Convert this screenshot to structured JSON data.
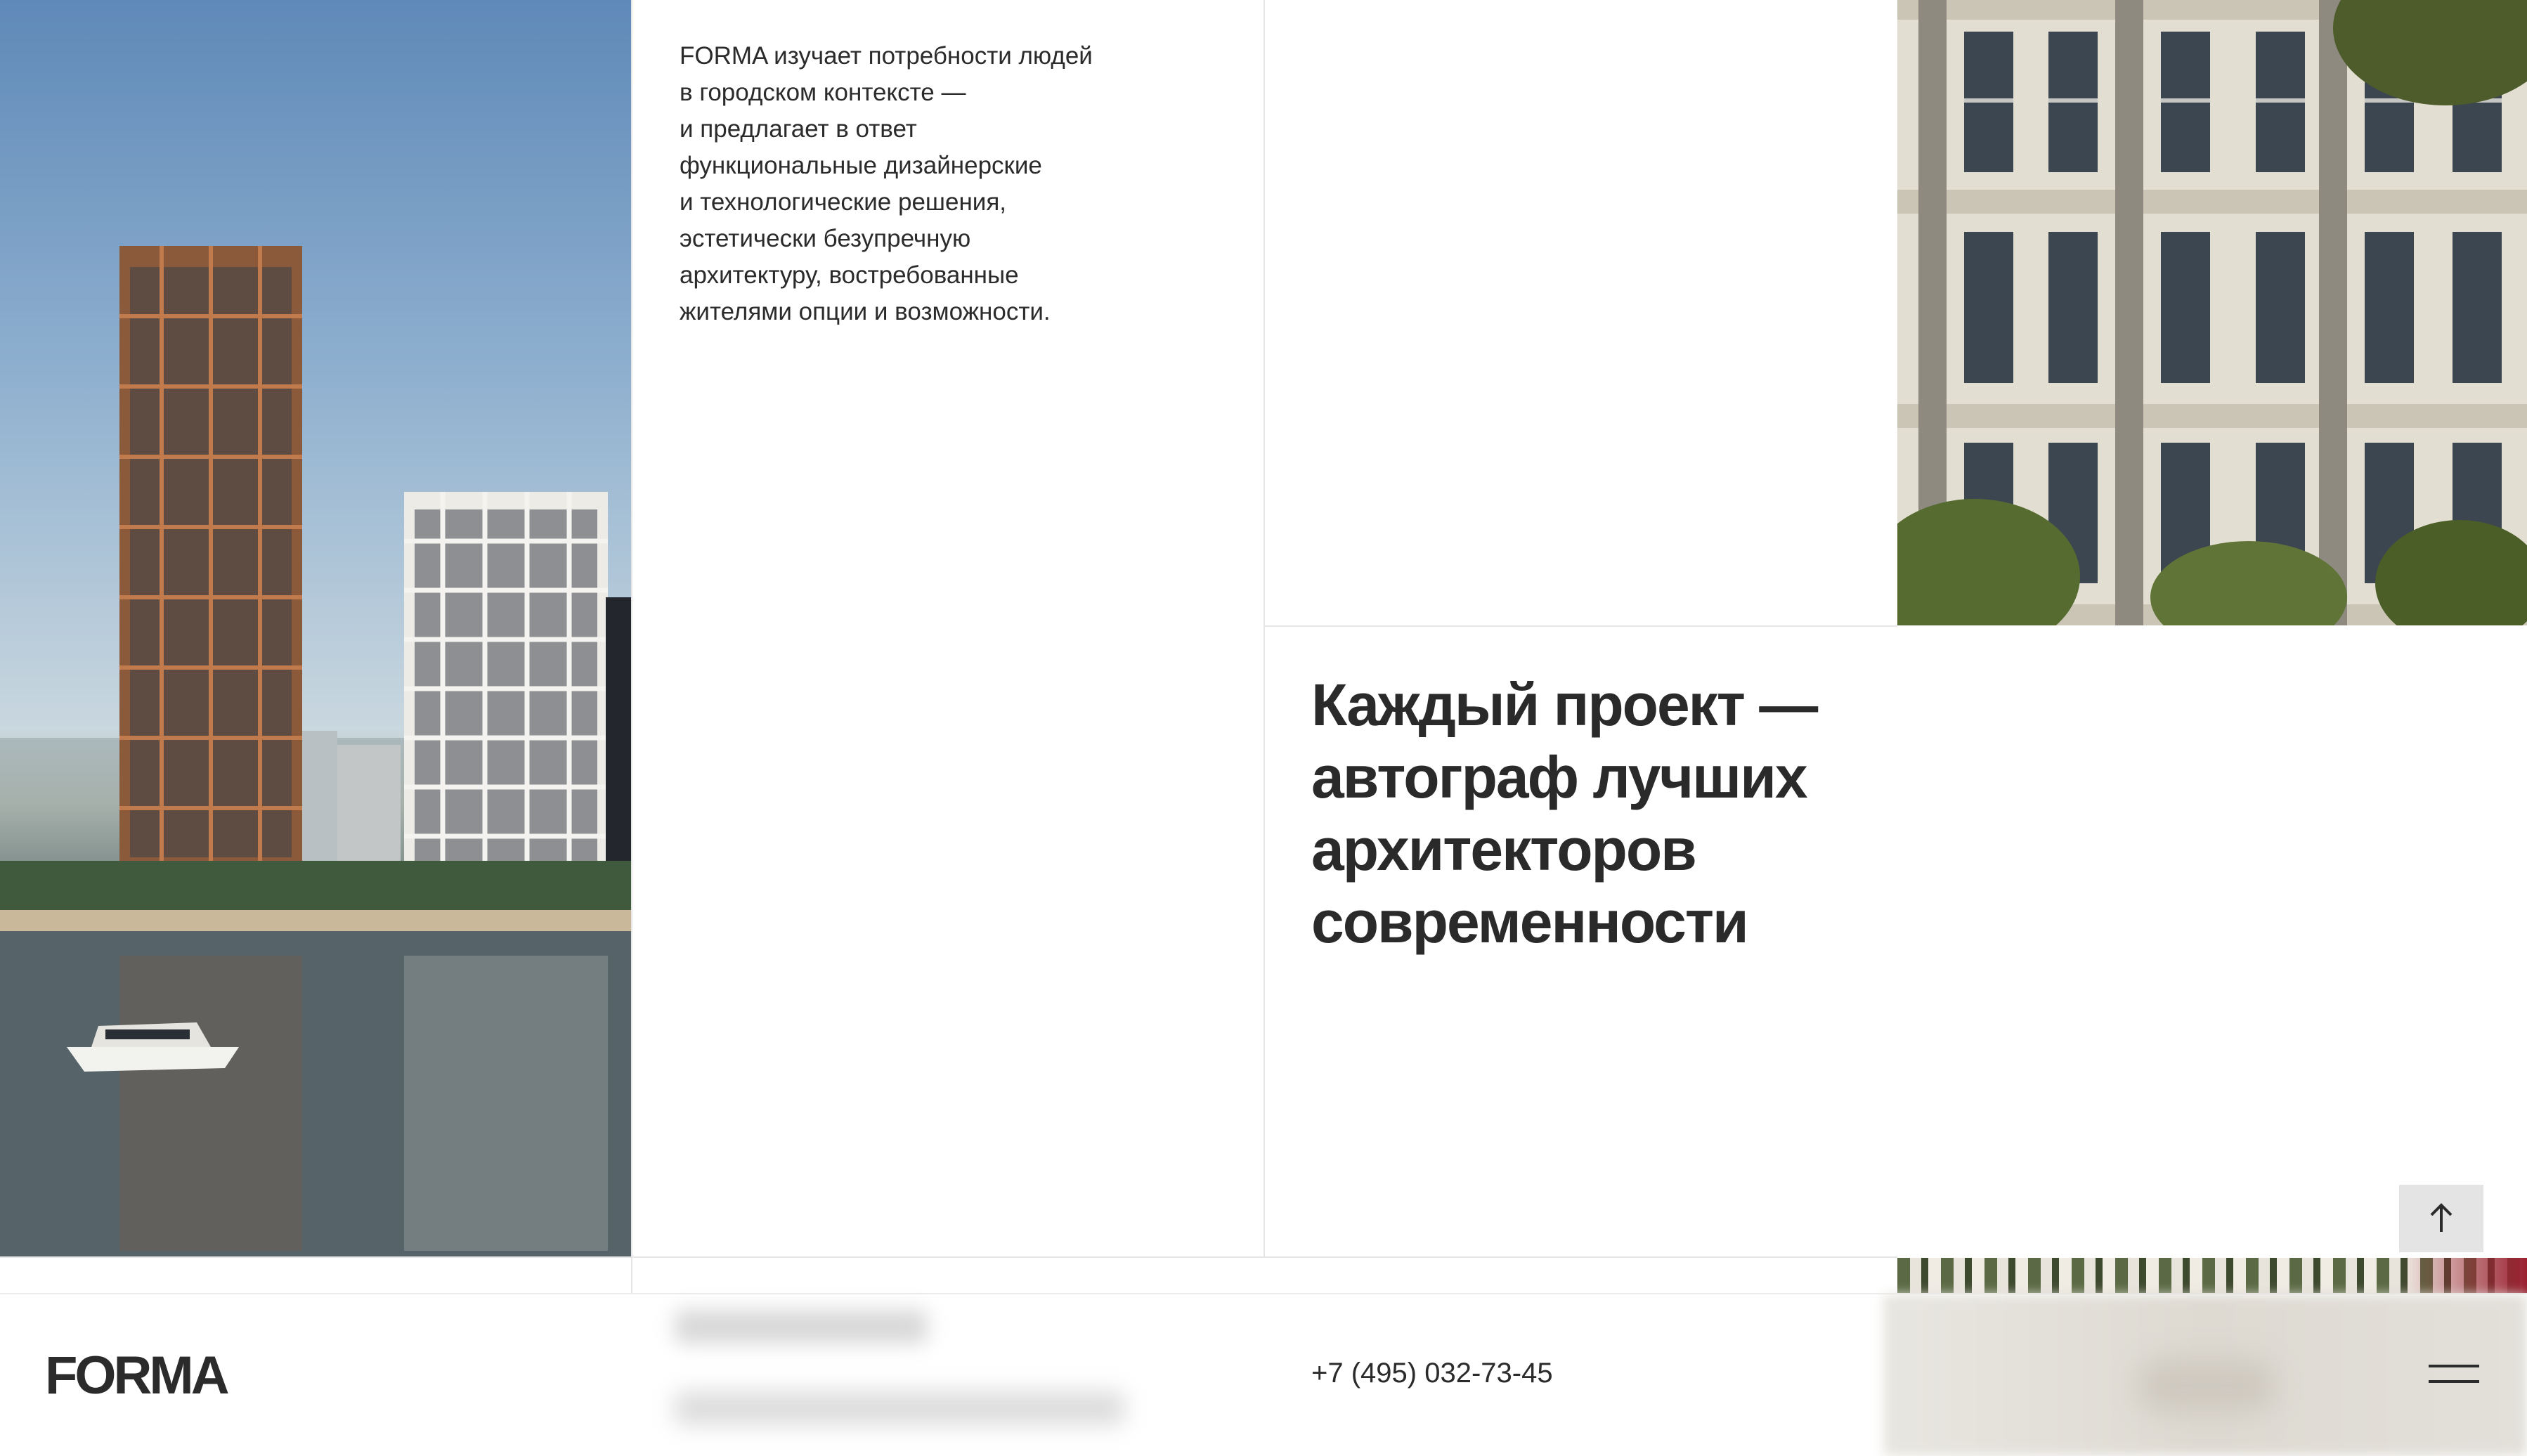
{
  "intro": {
    "text": "FORMA изучает потребности людей\nв городском контексте —\nи предлагает в ответ\nфункциональные дизайнерские\nи технологические решения,\nэстетически безупречную\nархитектуру, востребованные\nжителями опции и возможности."
  },
  "headline": {
    "text": "Каждый проект —\nавтограф лучших\nархитекторов\nсовременности"
  },
  "footer": {
    "logo": "FORMA",
    "phone": "+7 (495) 032-73-45"
  },
  "icons": {
    "scroll_top": "arrow-up-icon",
    "menu": "hamburger-menu-icon"
  },
  "colors": {
    "text": "#2a2a2a",
    "divider": "#e6e6e6",
    "button_bg": "#e4e4e4"
  }
}
